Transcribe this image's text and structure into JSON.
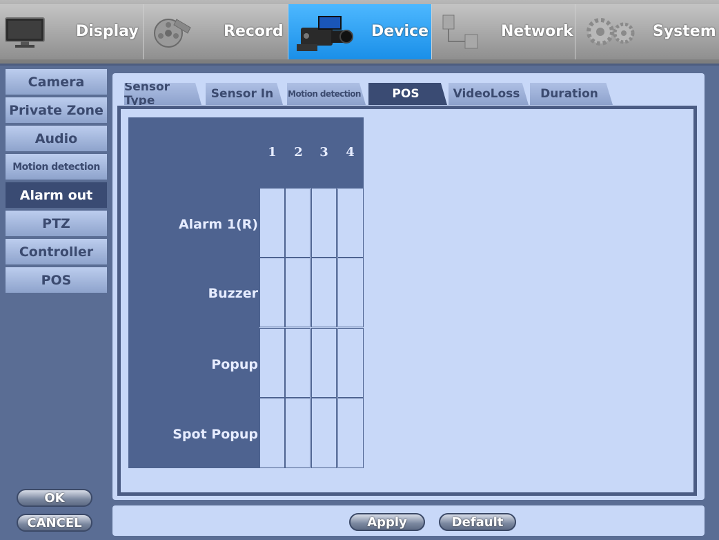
{
  "nav": {
    "tabs": [
      {
        "label": "Display",
        "icon": "monitor-icon"
      },
      {
        "label": "Record",
        "icon": "film-reel-icon"
      },
      {
        "label": "Device",
        "icon": "camcorder-icon",
        "active": true
      },
      {
        "label": "Network",
        "icon": "network-icon"
      },
      {
        "label": "System",
        "icon": "gears-icon"
      }
    ]
  },
  "menu": {
    "items": [
      "Camera",
      "Private Zone",
      "Audio",
      "Motion detection",
      "Alarm out",
      "PTZ",
      "Controller",
      "POS"
    ],
    "active": "Alarm out"
  },
  "subtabs": {
    "items": [
      "Sensor Type",
      "Sensor In",
      "Motion detection",
      "POS",
      "VideoLoss",
      "Duration"
    ],
    "active": "POS"
  },
  "grid": {
    "columns": [
      "1",
      "2",
      "3",
      "4"
    ],
    "rows": [
      "Alarm 1(R)",
      "Buzzer",
      "Popup",
      "Spot Popup"
    ]
  },
  "buttons": {
    "ok": "OK",
    "cancel": "CANCEL",
    "apply": "Apply",
    "default": "Default"
  },
  "colors": {
    "accent": "#1a8fe8",
    "panel": "#c8d8f8",
    "dark": "#4e6390"
  }
}
